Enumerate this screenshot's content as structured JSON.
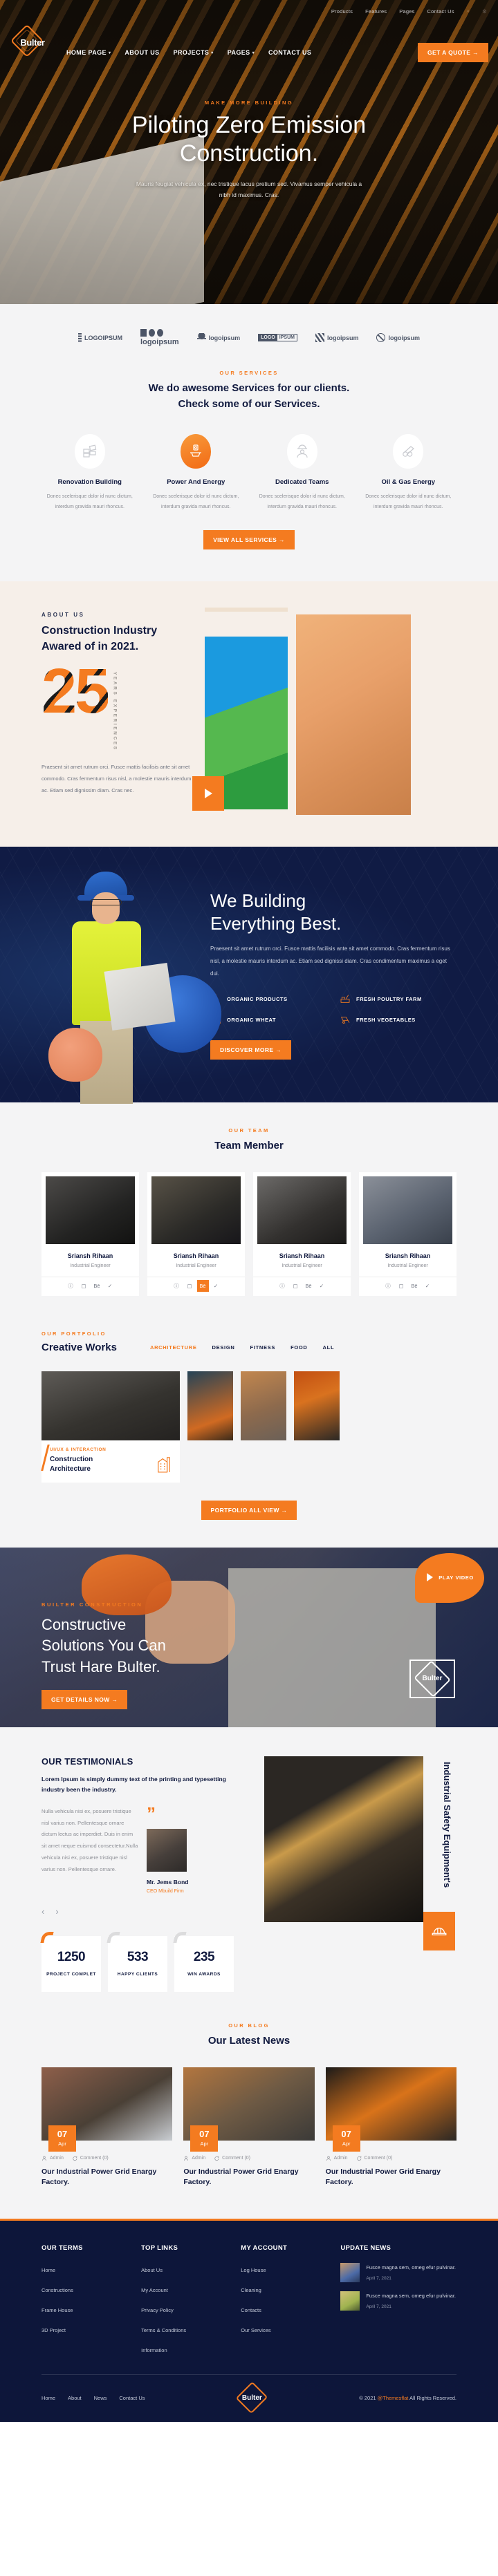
{
  "colors": {
    "accent": "#f47b20",
    "dark": "#111a3f",
    "footer": "#0d163a",
    "light": "#f4f4f5"
  },
  "header": {
    "topbar": [
      "Products",
      "Features",
      "Pages",
      "Contact Us"
    ],
    "brand": "Bulter",
    "nav": [
      {
        "label": "HOME PAGE",
        "caret": "▾"
      },
      {
        "label": "ABOUT US",
        "caret": ""
      },
      {
        "label": "PROJECTS",
        "caret": "▾"
      },
      {
        "label": "PAGES",
        "caret": "▾"
      },
      {
        "label": "CONTACT US",
        "caret": ""
      }
    ],
    "cta": "GET A QUOTE →"
  },
  "hero": {
    "eyebrow": "MAKE MORE BUILDING",
    "title_line1": "Piloting Zero Emission",
    "title_line2": "Construction.",
    "subtitle": "Mauris feugiat vehicula ex, nec tristique lacus pretium sed. Vivamus semper vehicula a nibh id maximus. Cras."
  },
  "brands": [
    {
      "name": "LOGOIPSUM",
      "icon": "wheat-icon"
    },
    {
      "name": "logoipsum",
      "icon": "shapes-icon"
    },
    {
      "name": "logoipsum",
      "icon": "wave-icon"
    },
    {
      "name": "LOGO IPSUM",
      "icon": "box-icon"
    },
    {
      "name": "logoipsum",
      "icon": "slash-icon"
    },
    {
      "name": "logoipsum",
      "icon": "circle-icon"
    }
  ],
  "services": {
    "eyebrow": "OUR SERVICES",
    "title_line1": "We do awesome Services for our clients.",
    "title_line2": "Check some of our Services.",
    "items": [
      {
        "title": "Renovation Building",
        "desc": "Donec scelerisque dolor id nunc dictum, interdum gravida mauri rhoncus.",
        "icon": "bricks-icon",
        "active": false
      },
      {
        "title": "Power And Energy",
        "desc": "Donec scelerisque dolor id nunc dictum, interdum gravida mauri rhoncus.",
        "icon": "lamp-icon",
        "active": true
      },
      {
        "title": "Dedicated Teams",
        "desc": "Donec scelerisque dolor id nunc dictum, interdum gravida mauri rhoncus.",
        "icon": "worker-icon",
        "active": false
      },
      {
        "title": "Oil & Gas Energy",
        "desc": "Donec scelerisque dolor id nunc dictum, interdum gravida mauri rhoncus.",
        "icon": "pipes-icon",
        "active": false
      }
    ],
    "cta": "VIEW ALL SERVICES →"
  },
  "about": {
    "eyebrow": "ABOUT US",
    "title_line1": "Construction Industry",
    "title_line2": "Awared of in 2021.",
    "years": "25",
    "years_label": "YEARS EXPERIENCES",
    "body": "Praesent sit amet rutrum orci. Fusce mattis facilisis ante sit amet commodo. Cras fermentum risus nisl, a molestie mauris interdum ac. Etiam sed dignissim diam. Cras nec."
  },
  "building": {
    "title_line1": "We Building",
    "title_line2": "Everything Best.",
    "body": "Praesent sit amet rutrum orci. Fusce mattis facilisis ante sit amet commodo. Cras fermentum risus nisl, a molestie mauris interdum ac. Etiam sed dignissi diam. Cras condimentum maximus a eget dui.",
    "features": [
      {
        "label": "ORGANIC PRODUCTS",
        "icon": "cone-icon"
      },
      {
        "label": "FRESH POULTRY FARM",
        "icon": "trowel-icon"
      },
      {
        "label": "ORGANIC WHEAT",
        "icon": "bricks-icon"
      },
      {
        "label": "FRESH VEGETABLES",
        "icon": "wheelbarrow-icon"
      }
    ],
    "cta": "DISCOVER MORE →"
  },
  "team": {
    "eyebrow": "OUR TEAM",
    "title": "Team Member",
    "members": [
      {
        "name": "Sriansh Rihaan",
        "role": "Industrial Engineer",
        "active_social": false
      },
      {
        "name": "Sriansh Rihaan",
        "role": "Industrial Engineer",
        "active_social": true
      },
      {
        "name": "Sriansh Rihaan",
        "role": "Industrial Engineer",
        "active_social": false
      },
      {
        "name": "Sriansh Rihaan",
        "role": "Industrial Engineer",
        "active_social": false
      }
    ],
    "socials": [
      "ⓘ",
      "▢",
      "Bē",
      "✓"
    ]
  },
  "portfolio": {
    "eyebrow": "OUR PORTFOLIO",
    "title": "Creative Works",
    "filters": [
      {
        "label": "ARCHITECTURE",
        "active": true
      },
      {
        "label": "DESIGN",
        "active": false
      },
      {
        "label": "FITNESS",
        "active": false
      },
      {
        "label": "FOOD",
        "active": false
      },
      {
        "label": "ALL",
        "active": false
      }
    ],
    "featured": {
      "tag": "UI/UX & INTERACTION",
      "title_line1": "Construction",
      "title_line2": "Architecture"
    },
    "cta": "PORTFOLIO ALL VIEW →"
  },
  "video": {
    "play_label": "PLAY VIDEO",
    "eyebrow": "BUILTER CONSTRUCTION",
    "title_line1": "Constructive",
    "title_line2": "Solutions You Can",
    "title_line3": "Trust Hare Bulter.",
    "badge": "Bulter",
    "cta": "GET DETAILS NOW →"
  },
  "testimonials": {
    "heading": "OUR TESTIMONIALS",
    "lead": "Lorem Ipsum is simply dummy text of the printing and typesetting industry been the industry.",
    "body": "Nulla vehicula nisi ex, posuere tristique nisl varius non. Pellentesque ornare dictum lectus ac imperdiet. Duis in enim sit amet neque euismod consectetur.Nulla vehicula nisi ex, posuere tristique nisl varius non. Pellentesque ornare.",
    "author": "Mr. Jems Bond",
    "author_role": "CEO Mbuild Firm",
    "prev": "‹",
    "next": "›",
    "stats": [
      {
        "number": "1250",
        "label": "PROJECT COMPLET"
      },
      {
        "number": "533",
        "label": "HAPPY CLIENTS"
      },
      {
        "number": "235",
        "label": "WIN AWARDS"
      }
    ],
    "side_title": "Industrial Safety Equipment's"
  },
  "blog": {
    "eyebrow": "OUR BLOG",
    "title": "Our Latest News",
    "posts": [
      {
        "day": "07",
        "month": "Apr",
        "author": "Admin",
        "comments": "Comment (0)",
        "title": "Our Industrial Power Grid Enargy Factory."
      },
      {
        "day": "07",
        "month": "Apr",
        "author": "Admin",
        "comments": "Comment (0)",
        "title": "Our Industrial Power Grid Enargy Factory."
      },
      {
        "day": "07",
        "month": "Apr",
        "author": "Admin",
        "comments": "Comment (0)",
        "title": "Our Industrial Power Grid Enargy Factory."
      }
    ]
  },
  "footer": {
    "columns": [
      {
        "title": "OUR TERMS",
        "links": [
          "Home",
          "Constructions",
          "Frame House",
          "3D Project"
        ]
      },
      {
        "title": "TOP LINKS",
        "links": [
          "About Us",
          "My Account",
          "Privacy Policy",
          "Terms & Conditions",
          "Information"
        ]
      },
      {
        "title": "MY ACCOUNT",
        "links": [
          "Log House",
          "Cleaning",
          "Contacts",
          "Our Services"
        ]
      }
    ],
    "news_title": "UPDATE NEWS",
    "news": [
      {
        "text": "Fusce magna sem, omeg efur pulvinar.",
        "date": "April 7, 2021"
      },
      {
        "text": "Fusce magna sem, omeg efur pulvinar.",
        "date": "April 7, 2021"
      }
    ],
    "bottom_links": [
      "Home",
      "About",
      "News",
      "Contact Us"
    ],
    "logo": "Bulter",
    "copyright_pre": "© 2021 ",
    "copyright_brand": "@Themesflat",
    "copyright_post": " All Rights Reserved."
  }
}
